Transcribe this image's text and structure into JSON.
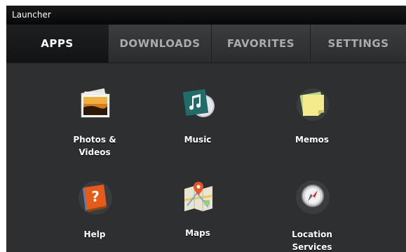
{
  "window": {
    "title": "Launcher"
  },
  "tabs": [
    {
      "label": "APPS",
      "active": true
    },
    {
      "label": "DOWNLOADS",
      "active": false
    },
    {
      "label": "FAVORITES",
      "active": false
    },
    {
      "label": "SETTINGS",
      "active": false
    }
  ],
  "apps": [
    {
      "icon": "photos-videos-icon",
      "label_line1": "Photos &",
      "label_line2": "Videos"
    },
    {
      "icon": "music-icon",
      "label_line1": "Music",
      "label_line2": ""
    },
    {
      "icon": "memos-icon",
      "label_line1": "Memos",
      "label_line2": ""
    },
    {
      "icon": "help-icon",
      "label_line1": "Help",
      "label_line2": ""
    },
    {
      "icon": "maps-icon",
      "label_line1": "Maps",
      "label_line2": ""
    },
    {
      "icon": "location-services-icon",
      "label_line1": "Location",
      "label_line2": "Services"
    }
  ],
  "colors": {
    "background": "#2d2f31",
    "titlebar": "#0a0a0a",
    "active_tab": "#161718",
    "inactive_tab_text": "#a9abad"
  }
}
